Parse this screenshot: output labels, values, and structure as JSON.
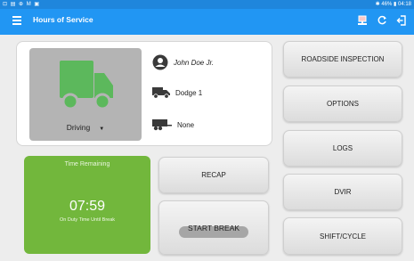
{
  "statusbar": {
    "left_icons": "⊡ ▤ ⊕ M ▣",
    "right_text": "✱ 46% ▮ 04:18"
  },
  "header": {
    "title": "Hours of Service"
  },
  "status": {
    "current": "Driving"
  },
  "driver": {
    "name": "John Doe Jr."
  },
  "vehicle": {
    "truck": "Dodge 1",
    "trailer": "None"
  },
  "time_panel": {
    "label": "Time Remaining",
    "value": "07:59",
    "sublabel": "On Duty Time Until Break"
  },
  "middle_buttons": {
    "recap": "RECAP",
    "start_break": "START BREAK"
  },
  "right_buttons": [
    {
      "label": "ROADSIDE INSPECTION"
    },
    {
      "label": "OPTIONS"
    },
    {
      "label": "LOGS"
    },
    {
      "label": "DVIR"
    },
    {
      "label": "SHIFT/CYCLE"
    }
  ],
  "colors": {
    "appbar": "#2196f3",
    "truck_icon": "#5cb85c",
    "time_panel": "#72b73c"
  }
}
